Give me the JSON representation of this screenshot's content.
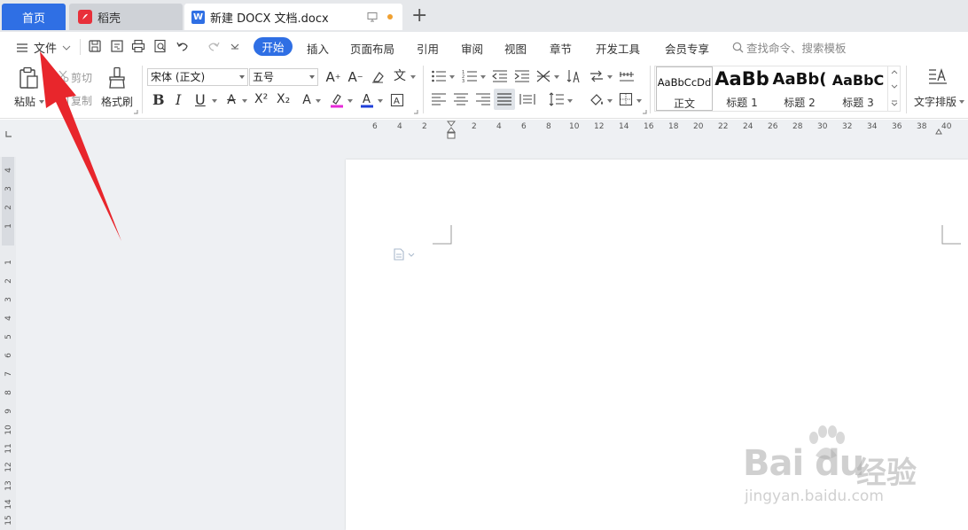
{
  "tabs": {
    "home": "首页",
    "daoke": "稻壳",
    "doc": "新建 DOCX 文档.docx"
  },
  "menu": {
    "file": "文件",
    "items": [
      "开始",
      "插入",
      "页面布局",
      "引用",
      "审阅",
      "视图",
      "章节",
      "开发工具",
      "会员专享"
    ],
    "search": "查找命令、搜索模板"
  },
  "ribbon": {
    "paste": "粘贴",
    "cut": "剪切",
    "copy": "复制",
    "format_painter": "格式刷",
    "font_name": "宋体 (正文)",
    "font_size": "五号",
    "bold": "B",
    "italic": "I",
    "underline": "U",
    "superscript": "X²",
    "subscript": "X₂",
    "styles": [
      {
        "preview": "AaBbCcDd",
        "name": "正文"
      },
      {
        "preview": "AaBb",
        "name": "标题 1"
      },
      {
        "preview": "AaBb(",
        "name": "标题 2"
      },
      {
        "preview": "AaBbC",
        "name": "标题 3"
      }
    ],
    "text_layout": "文字排版"
  },
  "ruler": {
    "h_ticks": [
      "6",
      "4",
      "2",
      "2",
      "4",
      "6",
      "8",
      "10",
      "12",
      "14",
      "16",
      "18",
      "20",
      "22",
      "24",
      "26",
      "28",
      "30",
      "32",
      "34",
      "36",
      "38",
      "40"
    ],
    "v_top_ticks": [
      "4",
      "3",
      "2",
      "1"
    ],
    "v_ticks": [
      "1",
      "2",
      "3",
      "4",
      "5",
      "6",
      "7",
      "8",
      "9",
      "10",
      "11",
      "12",
      "13",
      "14",
      "15"
    ]
  },
  "watermark": {
    "brand": "Bai du",
    "cn": "经验",
    "url": "jingyan.baidu.com"
  },
  "colors": {
    "accent": "#2f6fe4",
    "arrow": "#e8262c"
  }
}
